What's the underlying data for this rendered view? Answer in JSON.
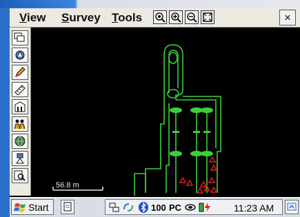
{
  "menubar": {
    "menus": [
      {
        "label": "View",
        "underline": "V",
        "rest": "iew"
      },
      {
        "label": "Survey",
        "underline": "S",
        "rest": "urvey"
      },
      {
        "label": "Tools",
        "underline": "T",
        "rest": "ools"
      }
    ],
    "tools": [
      "zoom-extents-icon",
      "zoom-in-icon",
      "zoom-out-icon",
      "zoom-window-icon"
    ],
    "close_label": "×"
  },
  "left_toolbar": {
    "buttons": [
      "layers-icon",
      "instrument-icon",
      "pencil-icon",
      "ruler-icon",
      "building-icon",
      "survey-team-icon",
      "globe-icon",
      "gps-icon",
      "search-icon"
    ]
  },
  "map": {
    "scale_label": "56.8 m",
    "colors": {
      "lines": "#3ccf3c",
      "points": "#e02020",
      "background": "#000000"
    }
  },
  "taskbar": {
    "start_label": "Start",
    "tray_badge_1": "100",
    "tray_badge_2": "PC",
    "clock": "11:23 AM"
  }
}
